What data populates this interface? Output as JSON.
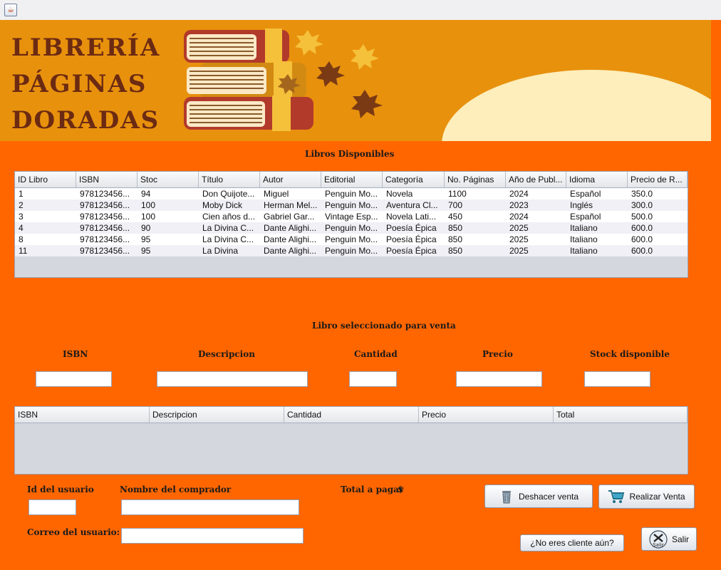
{
  "window": {
    "icon": "java-cup-icon"
  },
  "banner": {
    "title_lines": [
      "LIBRERÍA",
      "PÁGINAS",
      "DORADAS"
    ],
    "colors": {
      "background": "#e8910d",
      "title": "#6b2a12",
      "cream": "#fdeebb",
      "book_red": "#b23a2b",
      "book_yellow": "#f5c03a"
    }
  },
  "colors": {
    "form_background": "#ff6600"
  },
  "books_section": {
    "title": "Libros Disponibles"
  },
  "books_table": {
    "headers": [
      "ID Libro",
      "ISBN",
      "Stoc",
      "Título",
      "Autor",
      "Editorial",
      "Categoría",
      "No. Páginas",
      "Año de Publ...",
      "Idioma",
      "Precio de R..."
    ],
    "rows": [
      [
        "1",
        "978123456...",
        "94",
        "Don Quijote...",
        "Miguel",
        "Penguin Mo...",
        "Novela",
        "1100",
        "2024",
        "Español",
        "350.0"
      ],
      [
        "2",
        "978123456...",
        "100",
        "Moby Dick",
        "Herman Mel...",
        "Penguin Mo...",
        "Aventura Cl...",
        "700",
        "2023",
        "Inglés",
        "300.0"
      ],
      [
        "3",
        "978123456...",
        "100",
        "Cien años d...",
        "Gabriel Gar...",
        "Vintage Esp...",
        "Novela Lati...",
        "450",
        "2024",
        "Español",
        "500.0"
      ],
      [
        "4",
        "978123456...",
        "90",
        "La Divina C...",
        "Dante Alighi...",
        "Penguin Mo...",
        "Poesía Épica",
        "850",
        "2025",
        "Italiano",
        "600.0"
      ],
      [
        "8",
        "978123456...",
        "95",
        "La Divina C...",
        "Dante Alighi...",
        "Penguin Mo...",
        "Poesía Épica",
        "850",
        "2025",
        "Italiano",
        "600.0"
      ],
      [
        "11",
        "978123456...",
        "95",
        "La Divina",
        "Dante Alighi...",
        "Penguin Mo...",
        "Poesía Épica",
        "850",
        "2025",
        "Italiano",
        "600.0"
      ]
    ]
  },
  "selected_section": {
    "title": "Libro seleccionado para venta",
    "labels": {
      "isbn": "ISBN",
      "descripcion": "Descripcion",
      "cantidad": "Cantidad",
      "precio": "Precio",
      "stock": "Stock disponible"
    },
    "values": {
      "isbn": "",
      "descripcion": "",
      "cantidad": "",
      "precio": "",
      "stock": ""
    }
  },
  "sale_table": {
    "headers": [
      "ISBN",
      "Descripcion",
      "Cantidad",
      "Precio",
      "Total"
    ],
    "rows": []
  },
  "buyer": {
    "user_id_label": "Id del usuario",
    "user_id_value": "",
    "name_label": "Nombre del comprador",
    "name_value": "",
    "email_label": "Correo del usuario:",
    "email_value": ""
  },
  "total": {
    "label": "Total a pagar",
    "currency": "$",
    "value": ""
  },
  "buttons": {
    "undo": {
      "label": "Deshacer venta",
      "icon": "trash-can-icon"
    },
    "sell": {
      "label": "Realizar Venta",
      "icon": "shopping-cart-icon"
    },
    "register": {
      "label": "¿No eres cliente aún?"
    },
    "exit": {
      "label": "Salir",
      "icon": "exit-salir-icon",
      "icon_text": "Salir"
    }
  }
}
